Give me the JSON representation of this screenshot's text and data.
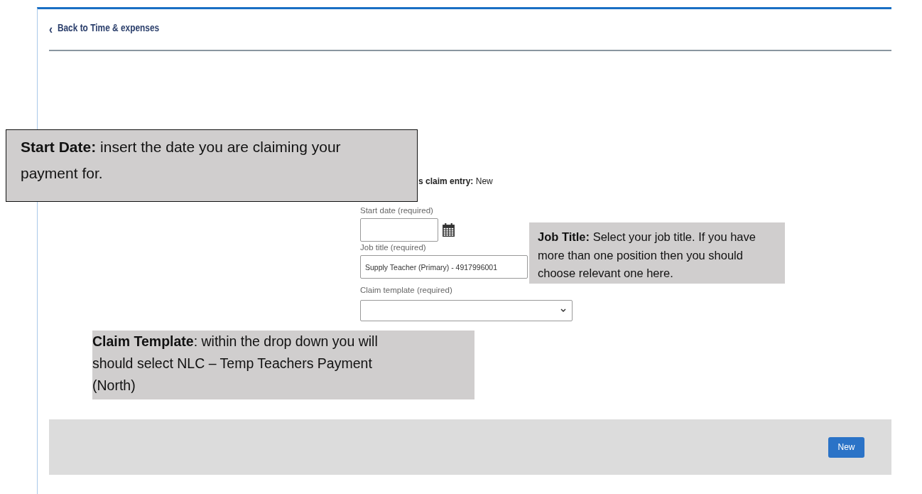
{
  "back_link": {
    "icon": "‹",
    "label": "Back to Time & expenses"
  },
  "form": {
    "entry_label": "s claim entry:",
    "entry_value": "New",
    "fields": [
      {
        "kind": "date",
        "label": "Start date (required)"
      },
      {
        "kind": "text",
        "label": "Job title (required)",
        "value": "Supply Teacher (Primary) - 4917996001"
      },
      {
        "kind": "select",
        "label": "Claim template (required)"
      }
    ]
  },
  "footer": {
    "buttons": [
      "New"
    ]
  },
  "callouts": [
    {
      "kind": "bordered",
      "text": "**Start Date:** insert the date you are claiming your payment for."
    },
    {
      "kind": "plain",
      "text": "**Job Title:** Select your job title. If you have more than one position then you should choose relevant one here."
    },
    {
      "kind": "plain",
      "text": "**Claim Template**: within the drop down you will should select NLC – Temp Teachers Payment (North)"
    }
  ]
}
